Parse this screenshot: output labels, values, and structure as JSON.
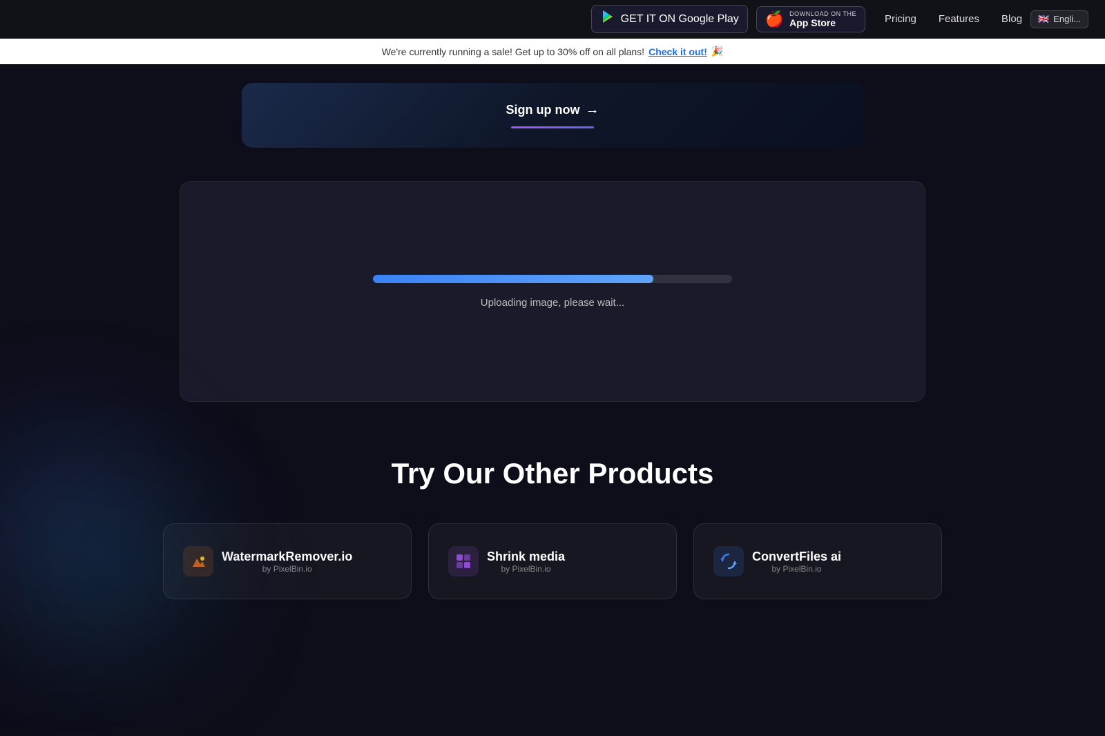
{
  "navbar": {
    "google_play": {
      "sub_label": "GET IT ON",
      "main_label": "Google Play"
    },
    "app_store": {
      "sub_label": "Download on the",
      "main_label": "App Store"
    },
    "links": [
      {
        "id": "pricing",
        "label": "Pricing"
      },
      {
        "id": "features",
        "label": "Features"
      },
      {
        "id": "blog",
        "label": "Blog"
      }
    ],
    "language": {
      "label": "Engli...",
      "flag": "🇬🇧"
    }
  },
  "sale_banner": {
    "text": "We're currently running a sale! Get up to 30% off on all plans!",
    "link_text": "Check it out!",
    "emoji": "🎉"
  },
  "signup_section": {
    "button_label": "Sign up now",
    "arrow": "→"
  },
  "upload_section": {
    "progress_percent": 78,
    "status_text": "Uploading image, please wait..."
  },
  "products_section": {
    "title": "Try Our Other Products",
    "products": [
      {
        "id": "watermark",
        "name": "WatermarkRemover.io",
        "by": "by PixelBin.io",
        "icon": "🔥"
      },
      {
        "id": "shrink",
        "name": "Shrink media",
        "by": "by PixelBin.io",
        "icon": "⊞"
      },
      {
        "id": "convert",
        "name": "ConvertFiles ai",
        "by": "by PixelBin.io",
        "icon": "⟳"
      }
    ]
  }
}
